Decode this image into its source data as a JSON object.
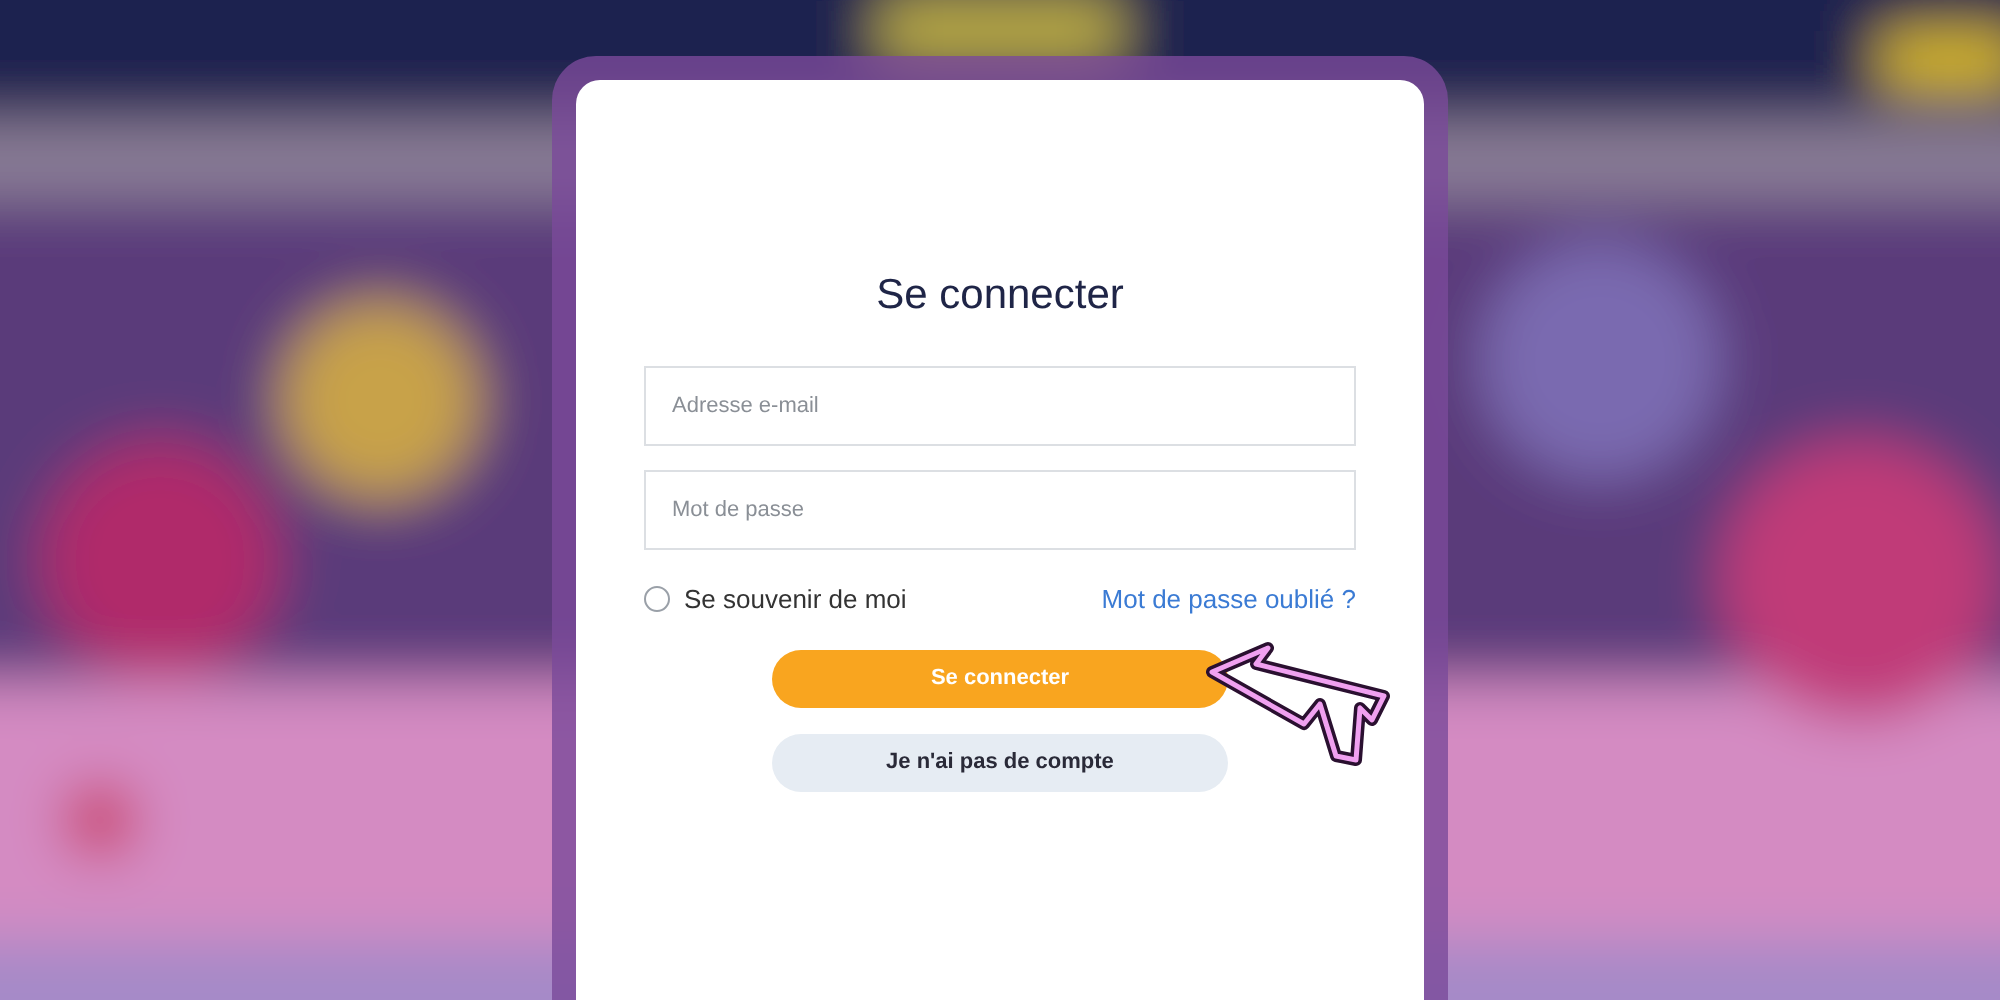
{
  "dialog": {
    "title": "Se connecter",
    "fields": [
      {
        "placeholder": "Adresse e-mail"
      },
      {
        "placeholder": "Mot de passe"
      }
    ],
    "remember": {
      "label": "Se souvenir de moi",
      "checked": false
    },
    "forgot_link": "Mot de passe oublié ?",
    "buttons": [
      {
        "label": "Se connecter",
        "kind": "primary"
      },
      {
        "label": "Je n'ai pas de compte",
        "kind": "secondary"
      }
    ]
  }
}
